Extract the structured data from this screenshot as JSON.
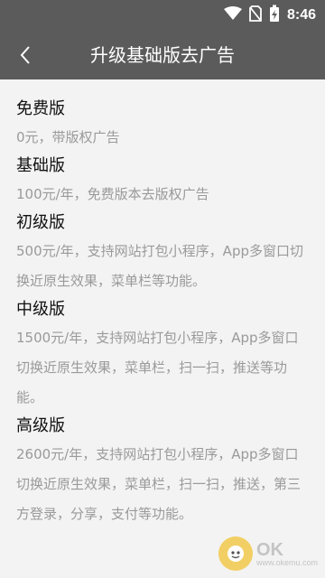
{
  "status_bar": {
    "time": "8:46",
    "icons": [
      "wifi-icon",
      "no-sim-icon",
      "battery-charging-icon"
    ]
  },
  "header": {
    "title": "升级基础版去广告",
    "back_icon": "back-arrow-icon"
  },
  "plans": [
    {
      "name": "免费版",
      "description": "0元，带版权广告"
    },
    {
      "name": "基础版",
      "description": "100元/年，免费版本去版权广告"
    },
    {
      "name": "初级版",
      "description": "500元/年，支持网站打包小程序，App多窗口切换近原生效果，菜单栏等功能。"
    },
    {
      "name": "中级版",
      "description": "1500元/年，支持网站打包小程序，App多窗口切换近原生效果，菜单栏，扫一扫，推送等功能。"
    },
    {
      "name": "高级版",
      "description": "2600元/年，支持网站打包小程序，App多窗口切换近原生效果，菜单栏，扫一扫，推送，第三方登录，分享，支付等功能。"
    }
  ],
  "watermark": {
    "main": "OK",
    "sub": "www.okemu.com"
  },
  "colors": {
    "header_bg": "#5b5b5b",
    "page_bg": "#f3f3f3",
    "plan_name": "#111111",
    "plan_desc": "#9a9a9a"
  }
}
